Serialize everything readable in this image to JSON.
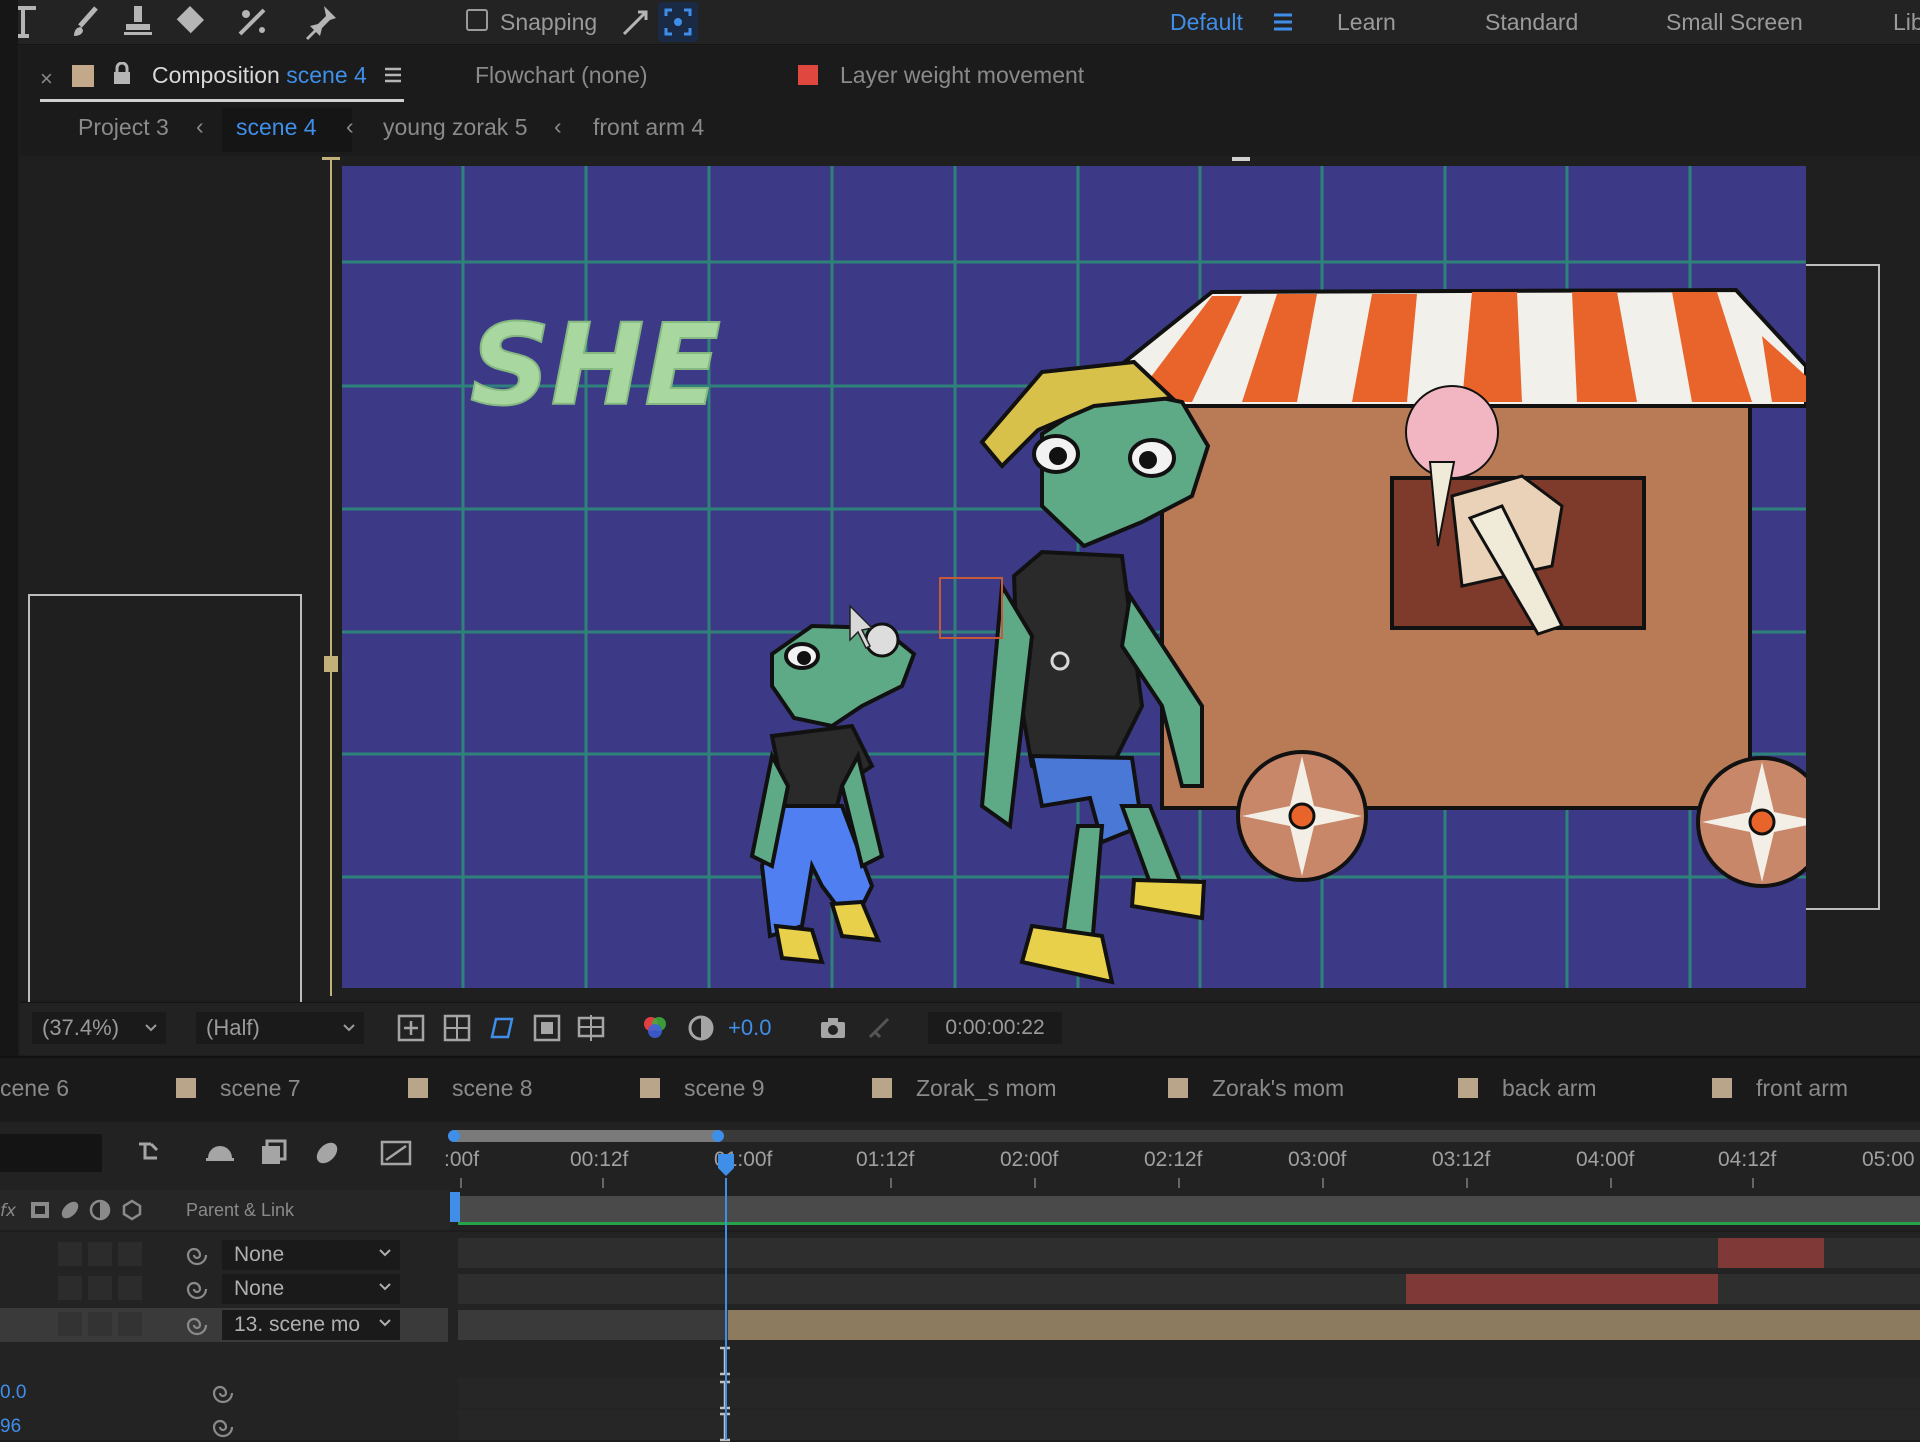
{
  "toolbar": {
    "tools": [
      "type-tool",
      "brush-tool",
      "clone-stamp-tool",
      "eraser-tool",
      "roto-brush-tool",
      "puppet-pin-tool"
    ],
    "snapping_label": "Snapping",
    "workspaces": [
      "Default",
      "Learn",
      "Standard",
      "Small Screen",
      "Lib"
    ],
    "active_workspace": "Default"
  },
  "panel": {
    "close": "×",
    "comp_label": "Composition",
    "comp_name": "scene 4",
    "flowchart": "Flowchart (none)",
    "layer_title": "Layer weight movement"
  },
  "breadcrumb": [
    "Project 3",
    "scene 4",
    "young zorak 5",
    "front arm 4"
  ],
  "breadcrumb_active": "scene 4",
  "artwork": {
    "text": "SHE"
  },
  "viewer": {
    "zoom": "(37.4%)",
    "resolution": "(Half)",
    "exposure": "+0.0",
    "timecode": "0:00:00:22"
  },
  "timeline_tabs": [
    "cene 6",
    "scene 7",
    "scene 8",
    "scene 9",
    "Zorak_s mom",
    "Zorak's mom",
    "back arm",
    "front  arm"
  ],
  "ruler": {
    "labels": [
      ":00f",
      "00:12f",
      "01:00f",
      "01:12f",
      "02:00f",
      "02:12f",
      "03:00f",
      "03:12f",
      "04:00f",
      "04:12f",
      "05:00"
    ]
  },
  "columns": {
    "parent_link": "Parent & Link"
  },
  "layers": [
    {
      "parent": "None"
    },
    {
      "parent": "None"
    },
    {
      "parent": "13. scene mo"
    }
  ],
  "properties": [
    {
      "value": "0.0"
    },
    {
      "value": "96"
    }
  ],
  "colors": {
    "accent_blue": "#3f8ee8",
    "comp_bg": "#3c3a86",
    "grid": "#2e8a78",
    "label_red": "#e0483f",
    "bar_red": "#7f3a38",
    "bar_tan": "#8c7b5e"
  }
}
